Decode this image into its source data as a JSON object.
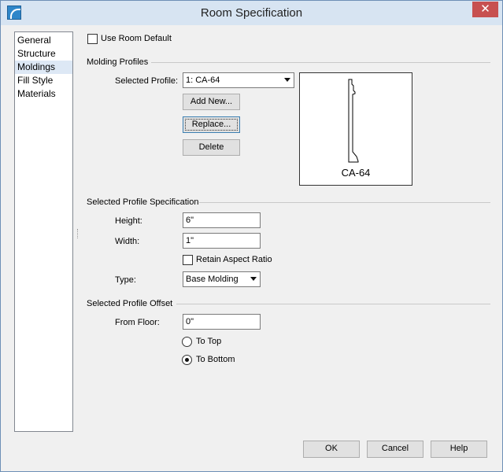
{
  "window": {
    "title": "Room Specification",
    "close_glyph": "✕"
  },
  "sidebar": {
    "items": [
      {
        "label": "General"
      },
      {
        "label": "Structure"
      },
      {
        "label": "Moldings"
      },
      {
        "label": "Fill Style"
      },
      {
        "label": "Materials"
      }
    ],
    "selected": "Moldings"
  },
  "use_room_default": {
    "label": "Use Room Default",
    "checked": false
  },
  "molding_profiles": {
    "section_title": "Molding Profiles",
    "selected_profile_label": "Selected Profile:",
    "selected_profile_value": "1:  CA-64",
    "add_new_label": "Add New...",
    "replace_label": "Replace...",
    "delete_label": "Delete",
    "preview_caption": "CA-64"
  },
  "spec": {
    "section_title": "Selected Profile Specification",
    "height_label": "Height:",
    "height_value": "6\"",
    "width_label": "Width:",
    "width_value": "1\"",
    "retain_aspect_label": "Retain Aspect Ratio",
    "retain_aspect_checked": false,
    "type_label": "Type:",
    "type_value": "Base Molding"
  },
  "offset": {
    "section_title": "Selected Profile Offset",
    "from_floor_label": "From Floor:",
    "from_floor_value": "0\"",
    "to_top_label": "To Top",
    "to_bottom_label": "To Bottom",
    "selected_radio": "To Bottom"
  },
  "footer": {
    "ok_label": "OK",
    "cancel_label": "Cancel",
    "help_label": "Help"
  }
}
